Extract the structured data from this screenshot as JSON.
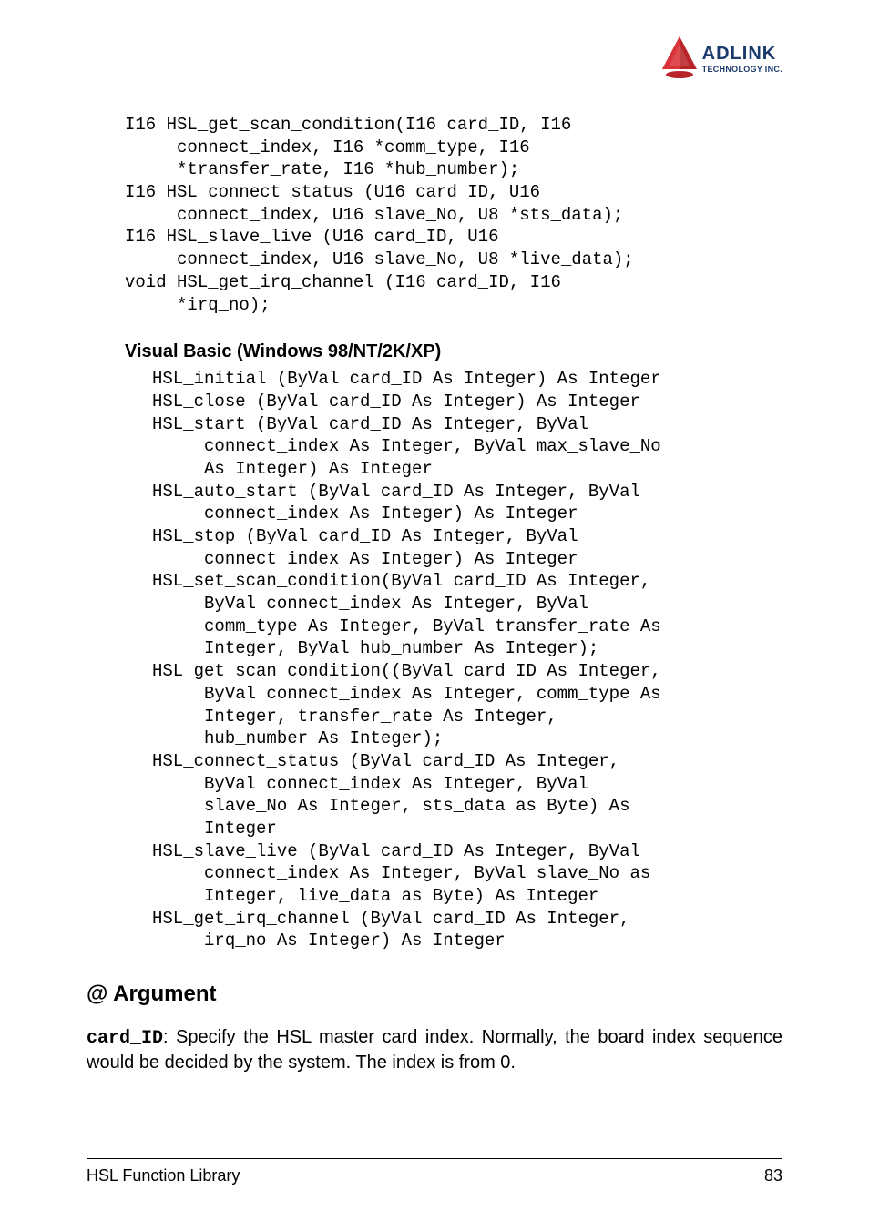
{
  "logo": {
    "brand": "ADLINK",
    "tagline": "TECHNOLOGY INC."
  },
  "code_block_c": "I16 HSL_get_scan_condition(I16 card_ID, I16\n     connect_index, I16 *comm_type, I16\n     *transfer_rate, I16 *hub_number);\nI16 HSL_connect_status (U16 card_ID, U16\n     connect_index, U16 slave_No, U8 *sts_data);\nI16 HSL_slave_live (U16 card_ID, U16\n     connect_index, U16 slave_No, U8 *live_data);\nvoid HSL_get_irq_channel (I16 card_ID, I16\n     *irq_no);",
  "vb_heading": "Visual Basic (Windows 98/NT/2K/XP)",
  "code_block_vb": "HSL_initial (ByVal card_ID As Integer) As Integer\nHSL_close (ByVal card_ID As Integer) As Integer\nHSL_start (ByVal card_ID As Integer, ByVal\n     connect_index As Integer, ByVal max_slave_No\n     As Integer) As Integer\nHSL_auto_start (ByVal card_ID As Integer, ByVal\n     connect_index As Integer) As Integer\nHSL_stop (ByVal card_ID As Integer, ByVal\n     connect_index As Integer) As Integer\nHSL_set_scan_condition(ByVal card_ID As Integer,\n     ByVal connect_index As Integer, ByVal\n     comm_type As Integer, ByVal transfer_rate As\n     Integer, ByVal hub_number As Integer);\nHSL_get_scan_condition((ByVal card_ID As Integer,\n     ByVal connect_index As Integer, comm_type As\n     Integer, transfer_rate As Integer,\n     hub_number As Integer);\nHSL_connect_status (ByVal card_ID As Integer,\n     ByVal connect_index As Integer, ByVal\n     slave_No As Integer, sts_data as Byte) As\n     Integer\nHSL_slave_live (ByVal card_ID As Integer, ByVal\n     connect_index As Integer, ByVal slave_No as\n     Integer, live_data as Byte) As Integer\nHSL_get_irq_channel (ByVal card_ID As Integer,\n     irq_no As Integer) As Integer",
  "argument": {
    "heading": "@ Argument",
    "param": "card_ID",
    "body_rest": ": Specify the HSL master card index. Normally, the board index sequence would be decided by the system. The index is from 0."
  },
  "footer": {
    "left": "HSL Function Library",
    "right": "83"
  }
}
